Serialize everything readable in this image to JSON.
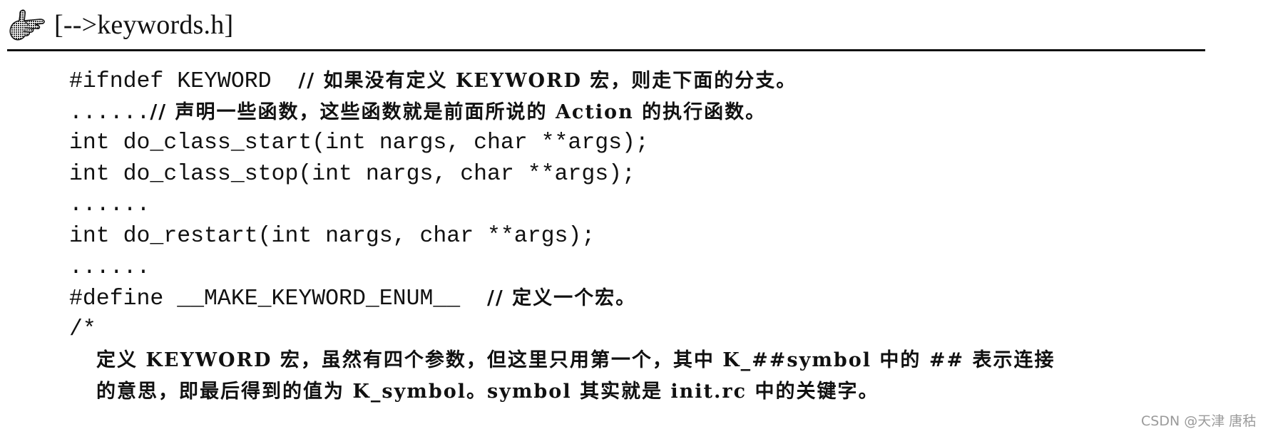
{
  "header": {
    "icon": "pointing-hand-icon",
    "title": "[-->keywords.h]"
  },
  "code_lines": [
    {
      "code": "#ifndef KEYWORD  ",
      "comment": "// 如果没有定义 KEYWORD 宏，则走下面的分支。"
    },
    {
      "code": "......",
      "comment": "// 声明一些函数，这些函数就是前面所说的 Action 的执行函数。"
    },
    {
      "code": "int do_class_start(int nargs, char **args);",
      "comment": ""
    },
    {
      "code": "int do_class_stop(int nargs, char **args);",
      "comment": ""
    },
    {
      "code": "......",
      "comment": ""
    },
    {
      "code": "int do_restart(int nargs, char **args);",
      "comment": ""
    },
    {
      "code": "......",
      "comment": ""
    },
    {
      "code": "#define __MAKE_KEYWORD_ENUM__  ",
      "comment": "// 定义一个宏。"
    },
    {
      "code": "/*",
      "comment": ""
    },
    {
      "code": "",
      "comment": "定义 KEYWORD 宏，虽然有四个参数，但这里只用第一个，其中 K_##symbol 中的 ## 表示连接"
    },
    {
      "code": "",
      "comment": "的意思，即最后得到的值为 K_symbol。symbol 其实就是 init.rc 中的关键字。"
    }
  ],
  "watermark": "CSDN @天津 唐秙"
}
